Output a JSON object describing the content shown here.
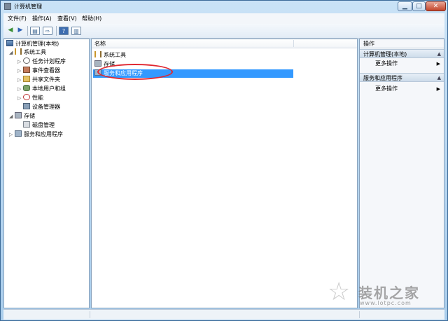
{
  "window": {
    "title": "计算机管理",
    "controls": {
      "minimize": "▁",
      "maximize": "□",
      "close": "✕"
    }
  },
  "menu": {
    "items": [
      {
        "label": "文件(F)"
      },
      {
        "label": "操作(A)"
      },
      {
        "label": "查看(V)"
      },
      {
        "label": "帮助(H)"
      }
    ]
  },
  "toolbar": {
    "back_icon": "arrow-left-icon",
    "forward_icon": "arrow-right-icon",
    "buttons": [
      "show-hide-tree",
      "export-list",
      "help",
      "show-hide-action-pane"
    ]
  },
  "tree": {
    "root": "计算机管理(本地)",
    "items": [
      {
        "label": "系统工具",
        "expander": "◢"
      },
      {
        "label": "任务计划程序",
        "expander": "▷"
      },
      {
        "label": "事件查看器",
        "expander": "▷"
      },
      {
        "label": "共享文件夹",
        "expander": "▷"
      },
      {
        "label": "本地用户和组",
        "expander": "▷"
      },
      {
        "label": "性能",
        "expander": "▷"
      },
      {
        "label": "设备管理器",
        "expander": ""
      },
      {
        "label": "存储",
        "expander": "◢"
      },
      {
        "label": "磁盘管理",
        "expander": ""
      },
      {
        "label": "服务和应用程序",
        "expander": "▷"
      }
    ]
  },
  "list": {
    "column_name": "名称",
    "rows": [
      {
        "label": "系统工具"
      },
      {
        "label": "存储"
      },
      {
        "label": "服务和应用程序",
        "selected": true
      }
    ],
    "selection_color": "#3399ff",
    "highlight_color": "#e0262f"
  },
  "actions": {
    "title": "操作",
    "sections": [
      {
        "title": "计算机管理(本地)",
        "item": "更多操作"
      },
      {
        "title": "服务和应用程序",
        "item": "更多操作"
      }
    ],
    "caret": "▲",
    "arrow": "▶"
  },
  "watermark": {
    "text": "装机之家",
    "url": "www.lotpc.com"
  }
}
